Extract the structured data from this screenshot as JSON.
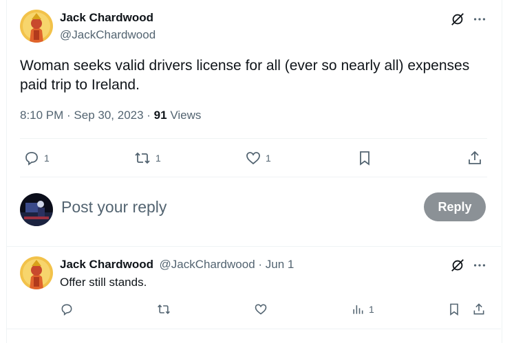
{
  "tweet": {
    "author_name": "Jack Chardwood",
    "author_handle": "@JackChardwood",
    "text": "Woman seeks valid drivers license for all (ever so nearly all) expenses paid trip to Ireland.",
    "time": "8:10 PM · Sep 30, 2023 · ",
    "views_count": "91",
    "views_label": " Views",
    "reply_count": "1",
    "retweet_count": "1",
    "like_count": "1"
  },
  "composer": {
    "placeholder": "Post your reply",
    "reply_button": "Reply"
  },
  "reply": {
    "author_name": "Jack Chardwood",
    "meta": "@JackChardwood · Jun 1",
    "text": "Offer still stands.",
    "views_count": "1"
  },
  "colors": {
    "secondary_text": "#536471",
    "reply_button_bg": "#8b9196",
    "divider": "#eff3f4"
  },
  "icons": [
    "grok-icon",
    "more-icon",
    "reply-icon",
    "retweet-icon",
    "like-icon",
    "bookmark-icon",
    "share-icon",
    "analytics-icon"
  ]
}
